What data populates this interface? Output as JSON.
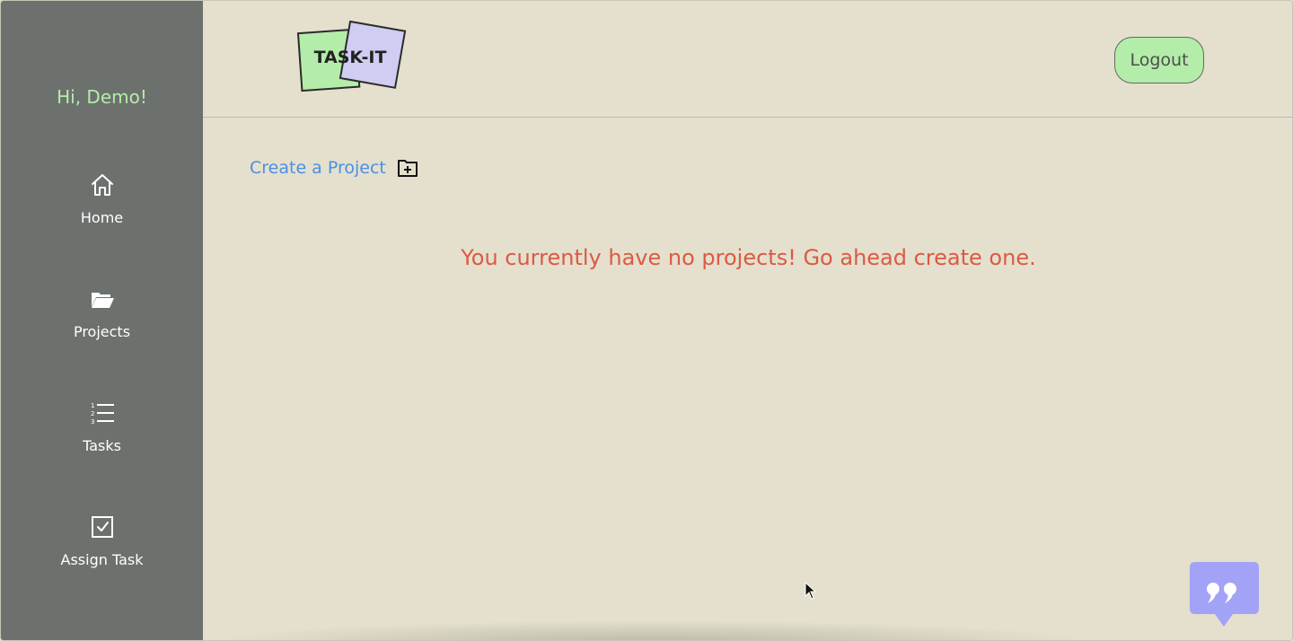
{
  "app": {
    "logo_text": "TASK-IT"
  },
  "sidebar": {
    "greeting": "Hi, Demo!",
    "items": [
      {
        "label": "Home",
        "icon": "home-icon"
      },
      {
        "label": "Projects",
        "icon": "folder-open-icon"
      },
      {
        "label": "Tasks",
        "icon": "numbered-list-icon"
      },
      {
        "label": "Assign Task",
        "icon": "checkbox-icon"
      }
    ]
  },
  "header": {
    "logout_label": "Logout"
  },
  "main": {
    "create_project_label": "Create a Project",
    "create_project_icon": "folder-plus-icon",
    "empty_message": "You currently have no projects! Go ahead create one."
  },
  "widgets": {
    "chat_icon": "quote-chat-icon"
  },
  "colors": {
    "sidebar_bg": "#6d716e",
    "page_bg": "#e4e0cd",
    "greeting": "#b4eca9",
    "link": "#4b8fe3",
    "empty_message": "#db5a44",
    "logout_bg": "#b4eca9",
    "chat_bg": "#a2a2f6"
  }
}
